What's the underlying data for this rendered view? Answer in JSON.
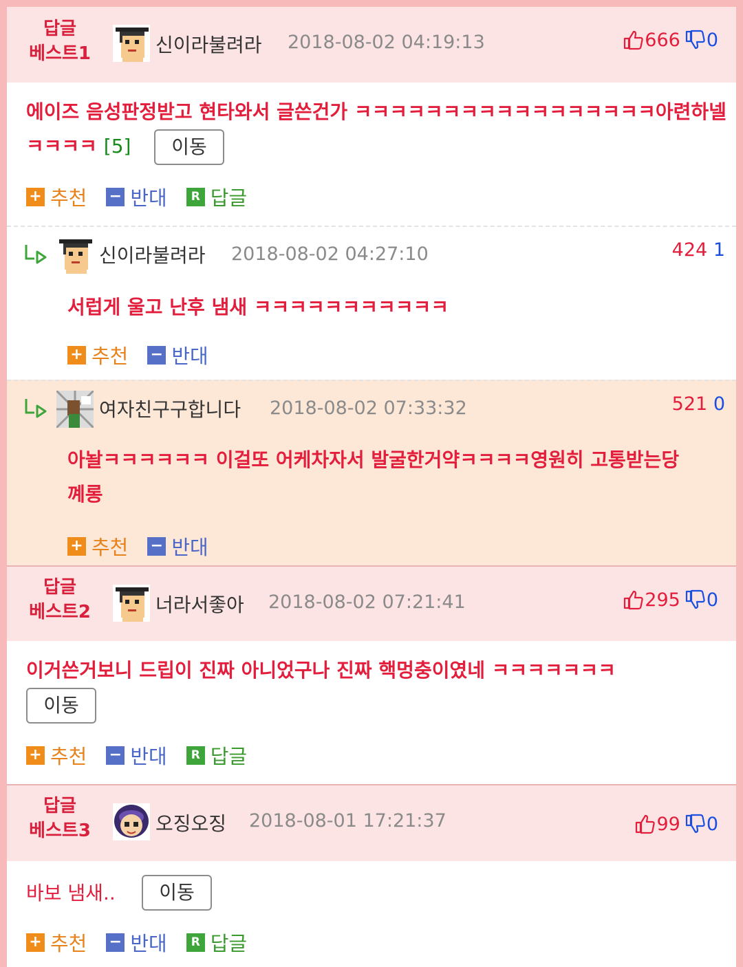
{
  "colors": {
    "border": "#f7b9b9",
    "best_header_bg": "#fde4e4",
    "highlight_bg": "#fde7d7",
    "accent_red": "#e21e3c",
    "accent_blue": "#1a4fe0"
  },
  "actions": {
    "recommend": "추천",
    "oppose": "반대",
    "reply": "답글"
  },
  "move_label": "이동",
  "best1": {
    "label_line1": "답글",
    "label_line2": "베스트1",
    "nick": "신이라불려라",
    "date": "2018-08-02 04:19:13",
    "up": "666",
    "down": "0",
    "text_line1": "에이즈 음성판정받고 현타와서 글쓴건가 ㅋㅋㅋㅋㅋㅋㅋㅋㅋㅋㅋㅋㅋㅋㅋㅋㅋ아련하넬",
    "text_line2": "ㅋㅋㅋㅋ",
    "reply_count": "[5]"
  },
  "reply1": {
    "nick": "신이라불려라",
    "date": "2018-08-02 04:27:10",
    "up": "424",
    "down": "1",
    "text": "서럽게 울고 난후 냄새 ㅋㅋㅋㅋㅋㅋㅋㅋㅋㅋㅋ"
  },
  "reply2": {
    "nick": "여자친구구합니다",
    "date": "2018-08-02 07:33:32",
    "up": "521",
    "down": "0",
    "text_line1": "아놜ㅋㅋㅋㅋㅋㅋ 이걸또 어케차자서 발굴한거약ㅋㅋㅋㅋ영원히 고통받는당",
    "text_line2": "꼐롱"
  },
  "best2": {
    "label_line1": "답글",
    "label_line2": "베스트2",
    "nick": "너라서좋아",
    "date": "2018-08-02 07:21:41",
    "up": "295",
    "down": "0",
    "text": "이거쓴거보니 드립이 진짜 아니었구나 진짜 핵멍충이였네 ㅋㅋㅋㅋㅋㅋㅋ"
  },
  "best3": {
    "label_line1": "답글",
    "label_line2": "베스트3",
    "nick": "오징오징",
    "date": "2018-08-01 17:21:37",
    "up": "99",
    "down": "0",
    "text": "바보 냄새.."
  }
}
